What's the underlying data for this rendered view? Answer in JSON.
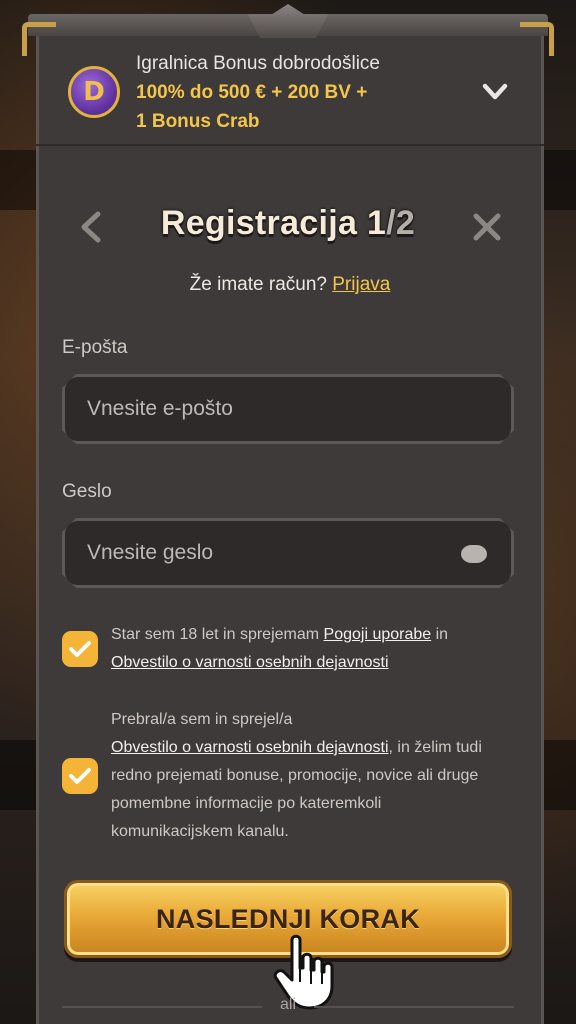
{
  "colors": {
    "accent": "#f3c64b",
    "panel": "#3e3a39",
    "input_bg": "#2e2a29",
    "checkbox": "#f3b437"
  },
  "bonus": {
    "title": "Igralnica Bonus dobrodošlice",
    "offer_line1": "100% do 500 € + 200 BV +",
    "offer_line2": "1 Bonus Crab",
    "logo_letter": "D",
    "expand_icon": "chevron-down-icon"
  },
  "header": {
    "title": "Registracija 1",
    "step_total": "/2",
    "back_icon": "chevron-left-icon",
    "close_icon": "close-icon"
  },
  "login": {
    "prompt": "Že imate račun?",
    "link": "Prijava"
  },
  "email": {
    "label": "E-pošta",
    "placeholder": "Vnesite e-pošto",
    "value": ""
  },
  "password": {
    "label": "Geslo",
    "placeholder": "Vnesite geslo",
    "value": "",
    "toggle_icon": "eye-icon"
  },
  "consent1": {
    "checked": true,
    "text_pre": "Star sem 18 let in sprejemam ",
    "link_terms": "Pogoji uporabe",
    "text_mid": " in ",
    "link_privacy": "Obvestilo o varnosti osebnih dejavnosti"
  },
  "consent2": {
    "checked": true,
    "text_pre": "Prebral/a sem in sprejel/a",
    "link_privacy": "Obvestilo o varnosti osebnih dejavnosti",
    "text_post": ", in želim tudi redno prejemati bonuse, promocije, novice ali druge pomembne informacije po katerem­koli komunikacijskem kanalu."
  },
  "next_button": {
    "label": "NASLEDNJI KORAK"
  },
  "divider": {
    "or_text": "ali"
  }
}
